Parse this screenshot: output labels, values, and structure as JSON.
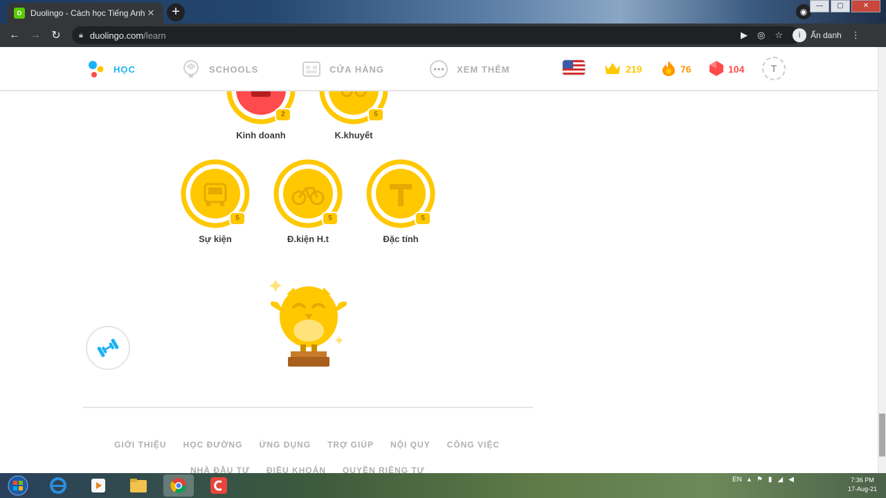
{
  "browser": {
    "tab_title": "Duolingo - Cách học Tiếng Anh",
    "tab_favicon": "duo",
    "url_host": "duolingo.com",
    "url_path": "/learn",
    "profile_label": "Ẩn danh",
    "profile_initial": "i"
  },
  "header": {
    "nav": [
      {
        "label": "HỌC",
        "icon": "learn-icon",
        "active": true
      },
      {
        "label": "SCHOOLS",
        "icon": "schools-icon",
        "active": false
      },
      {
        "label": "CỬA HÀNG",
        "icon": "shop-icon",
        "active": false
      },
      {
        "label": "XEM THÊM",
        "icon": "more-icon",
        "active": false
      }
    ],
    "course_flag": "us-flag-icon",
    "crowns": "219",
    "streak": "76",
    "gems": "104",
    "avatar_initial": "T"
  },
  "skills": {
    "top_row": [
      {
        "label": "Kinh doanh",
        "crown": "2"
      },
      {
        "label": "K.khuyết",
        "crown": "5"
      }
    ],
    "bottom_row": [
      {
        "label": "Sự kiện",
        "crown": "5"
      },
      {
        "label": "Đ.kiện H.t",
        "crown": "5"
      },
      {
        "label": "Đặc tính",
        "crown": "5"
      }
    ]
  },
  "footer": {
    "row1": [
      "GIỚI THIỆU",
      "HỌC ĐƯỜNG",
      "ỨNG DỤNG",
      "TRỢ GIÚP",
      "NỘI QUY",
      "CÔNG VIỆC"
    ],
    "row2": [
      "NHÀ ĐẦU TƯ",
      "ĐIỀU KHOẢN",
      "QUYỀN RIÊNG TƯ"
    ]
  },
  "taskbar": {
    "lang": "EN",
    "time": "7:36 PM",
    "date": "17-Aug-21"
  },
  "colors": {
    "accent_blue": "#1cb0f6",
    "gold": "#ffc800",
    "streak_orange": "#ff9600",
    "gem_red": "#ff4b4b"
  }
}
